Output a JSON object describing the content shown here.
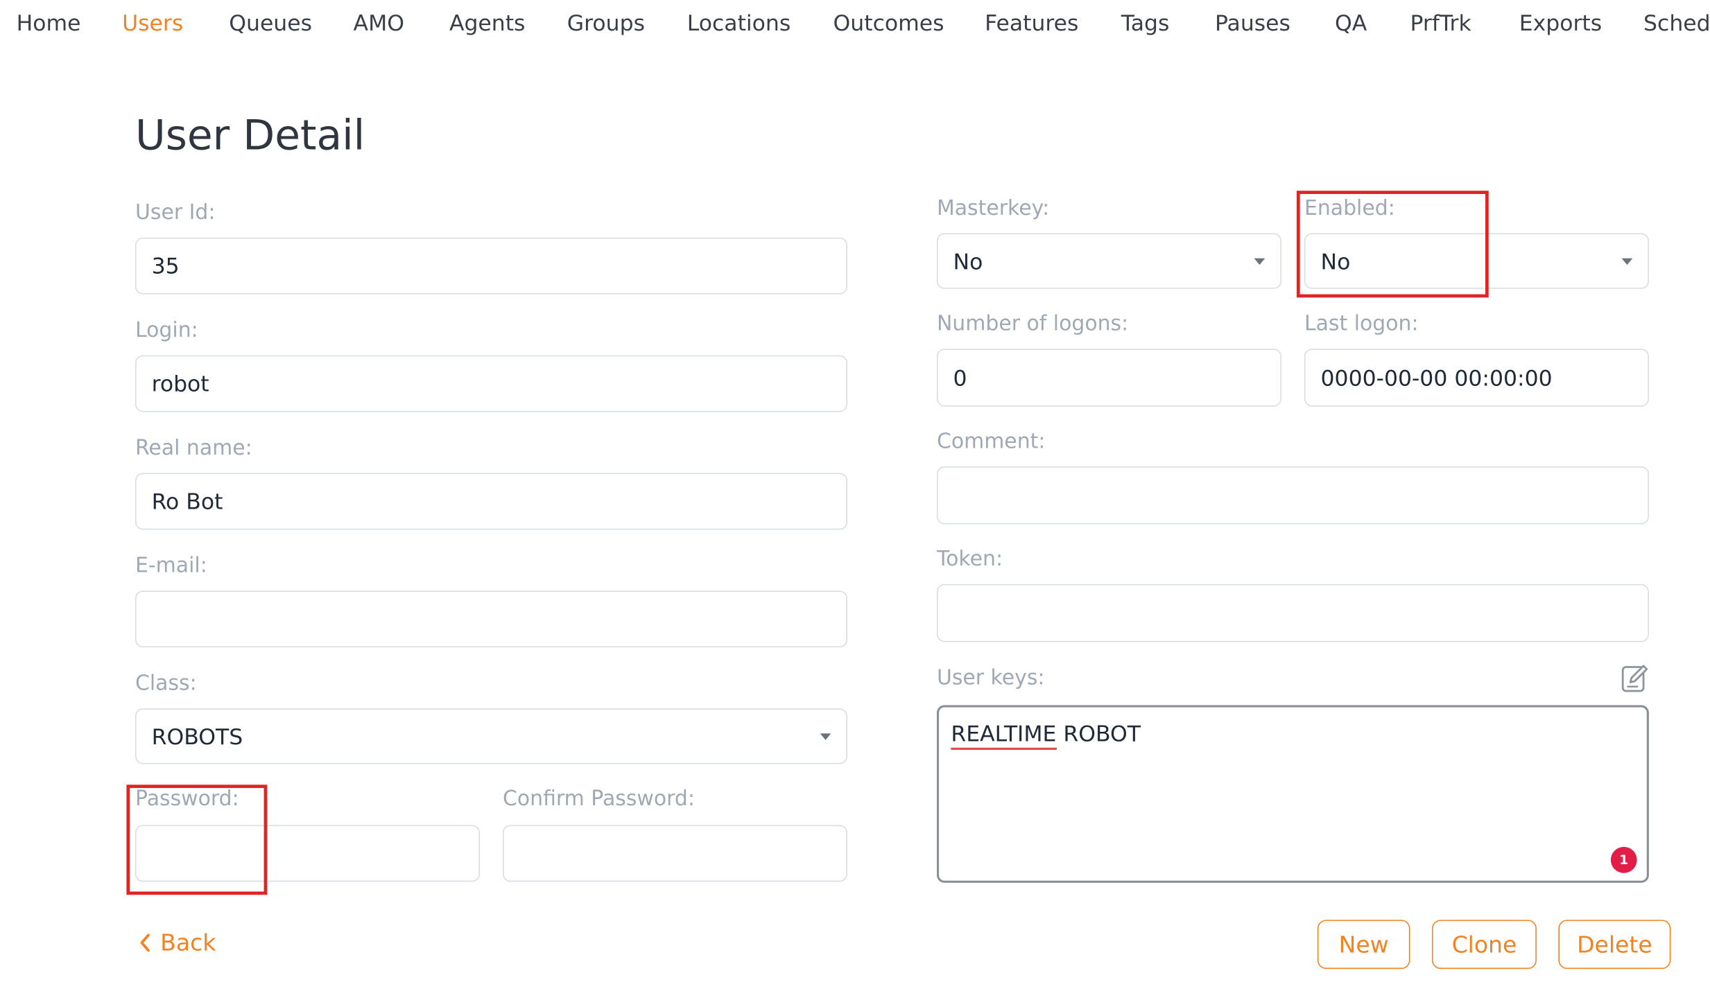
{
  "nav": {
    "items": [
      {
        "label": "Home"
      },
      {
        "label": "Users",
        "active": true
      },
      {
        "label": "Queues"
      },
      {
        "label": "AMO"
      },
      {
        "label": "Agents"
      },
      {
        "label": "Groups"
      },
      {
        "label": "Locations"
      },
      {
        "label": "Outcomes"
      },
      {
        "label": "Features"
      },
      {
        "label": "Tags"
      },
      {
        "label": "Pauses"
      },
      {
        "label": "QA"
      },
      {
        "label": "PrfTrk"
      },
      {
        "label": "Exports"
      },
      {
        "label": "Sched"
      }
    ]
  },
  "page": {
    "title": "User Detail"
  },
  "form": {
    "user_id": {
      "label": "User Id:",
      "value": "35"
    },
    "login": {
      "label": "Login:",
      "value": "robot"
    },
    "real_name": {
      "label": "Real name:",
      "value": "Ro Bot"
    },
    "email": {
      "label": "E-mail:",
      "value": ""
    },
    "class": {
      "label": "Class:",
      "value": "ROBOTS"
    },
    "password": {
      "label": "Password:",
      "value": ""
    },
    "confirm_password": {
      "label": "Confirm Password:",
      "value": ""
    },
    "masterkey": {
      "label": "Masterkey:",
      "value": "No"
    },
    "enabled": {
      "label": "Enabled:",
      "value": "No"
    },
    "number_of_logons": {
      "label": "Number of logons:",
      "value": "0"
    },
    "last_logon": {
      "label": "Last logon:",
      "value": "0000-00-00 00:00:00"
    },
    "comment": {
      "label": "Comment:",
      "value": ""
    },
    "token": {
      "label": "Token:",
      "value": ""
    },
    "user_keys": {
      "label": "User keys:",
      "value_part1": "REALTIME",
      "value_part2": " ROBOT",
      "badge": "1"
    }
  },
  "actions": {
    "back": "Back",
    "new": "New",
    "clone": "Clone",
    "delete": "Delete"
  },
  "colors": {
    "accent": "#f58220",
    "label": "#a0a8b4",
    "highlight": "#e02424",
    "badge": "#e11d48"
  },
  "icons": {
    "edit": "edit-icon",
    "back": "chevron-left-icon",
    "select": "caret-down-icon"
  }
}
